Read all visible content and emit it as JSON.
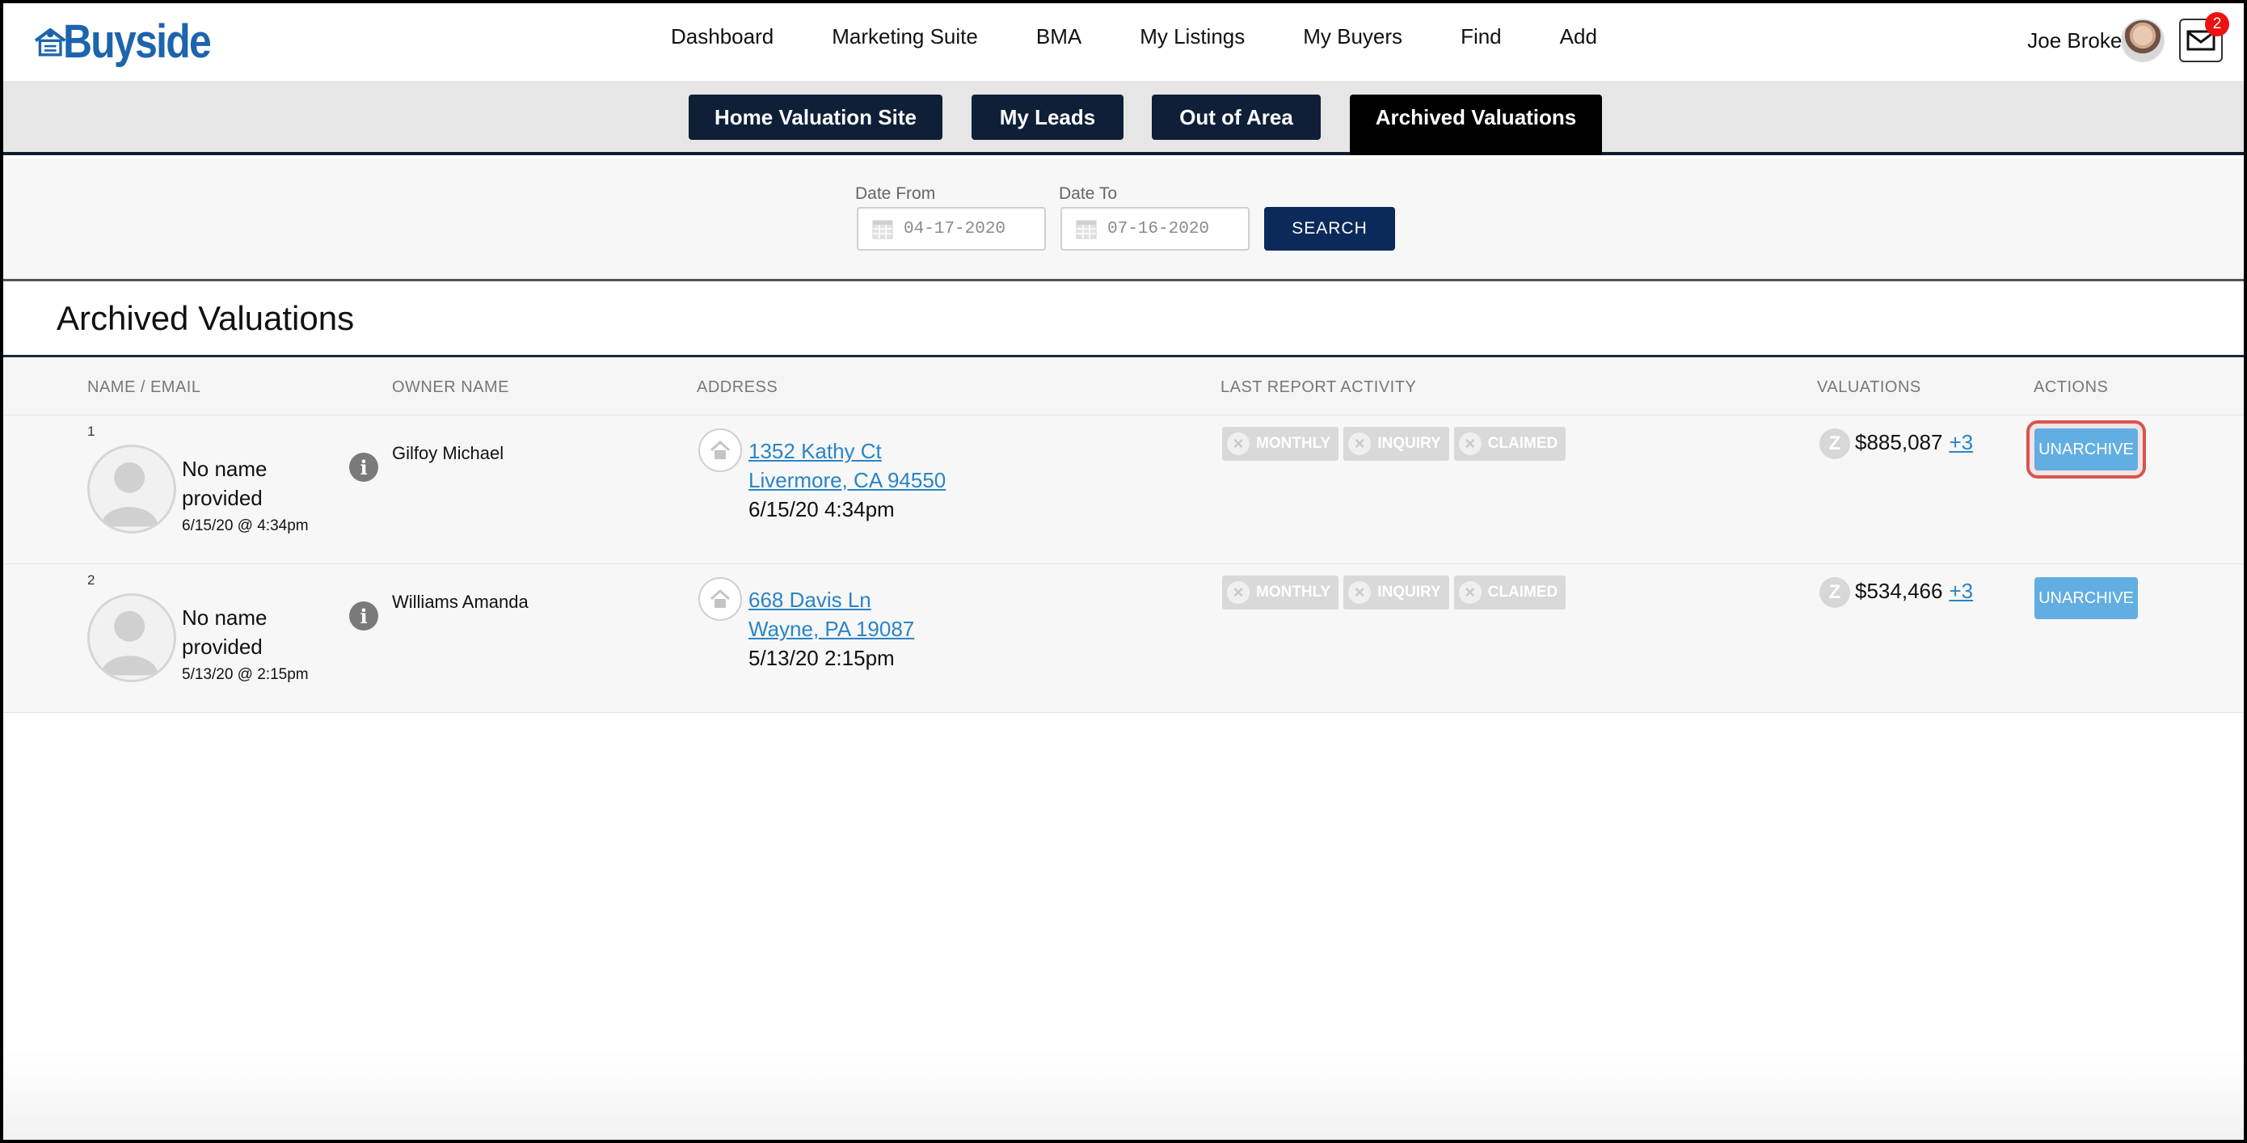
{
  "brand": {
    "name": "Buyside",
    "logo_color": "#1c64ad"
  },
  "nav": {
    "items": [
      "Dashboard",
      "Marketing Suite",
      "BMA",
      "My Listings",
      "My Buyers",
      "Find",
      "Add"
    ]
  },
  "user": {
    "name": "Joe Broker",
    "mail_badge": "2"
  },
  "subtabs": [
    {
      "label": "Home Valuation Site"
    },
    {
      "label": "My Leads"
    },
    {
      "label": "Out of Area"
    },
    {
      "label": "Archived Valuations",
      "active": true
    }
  ],
  "filter": {
    "date_from_label": "Date From",
    "date_from_value": "04-17-2020",
    "date_to_label": "Date To",
    "date_to_value": "07-16-2020",
    "search_label": "SEARCH"
  },
  "section": {
    "title": "Archived Valuations"
  },
  "table": {
    "headers": {
      "name": "NAME / EMAIL",
      "owner": "OWNER NAME",
      "address": "ADDRESS",
      "activity": "LAST REPORT ACTIVITY",
      "valuations": "VALUATIONS",
      "actions": "ACTIONS"
    },
    "rows": [
      {
        "num": "1",
        "name_line1": "No name",
        "name_line2": "provided",
        "date": "6/15/20 @ 4:34pm",
        "owner": "Gilfoy Michael",
        "street": "1352 Kathy Ct",
        "city": "Livermore, CA 94550",
        "addr_date": "6/15/20 4:34pm",
        "badges": [
          "MONTHLY",
          "INQUIRY",
          "CLAIMED"
        ],
        "valuation": "$885,087",
        "more": "+3",
        "action": "UNARCHIVE",
        "highlighted": true
      },
      {
        "num": "2",
        "name_line1": "No name",
        "name_line2": "provided",
        "date": "5/13/20 @ 2:15pm",
        "owner": "Williams Amanda",
        "street": "668 Davis Ln",
        "city": "Wayne, PA 19087",
        "addr_date": "5/13/20 2:15pm",
        "badges": [
          "MONTHLY",
          "INQUIRY",
          "CLAIMED"
        ],
        "valuation": "$534,466",
        "more": "+3",
        "action": "UNARCHIVE",
        "highlighted": false
      }
    ]
  },
  "colors": {
    "navy": "#0f1f38",
    "link": "#2a84c6",
    "button_light_blue": "#62aee3",
    "search_button": "#0b2a5b",
    "highlight_outline": "#d9534f"
  }
}
